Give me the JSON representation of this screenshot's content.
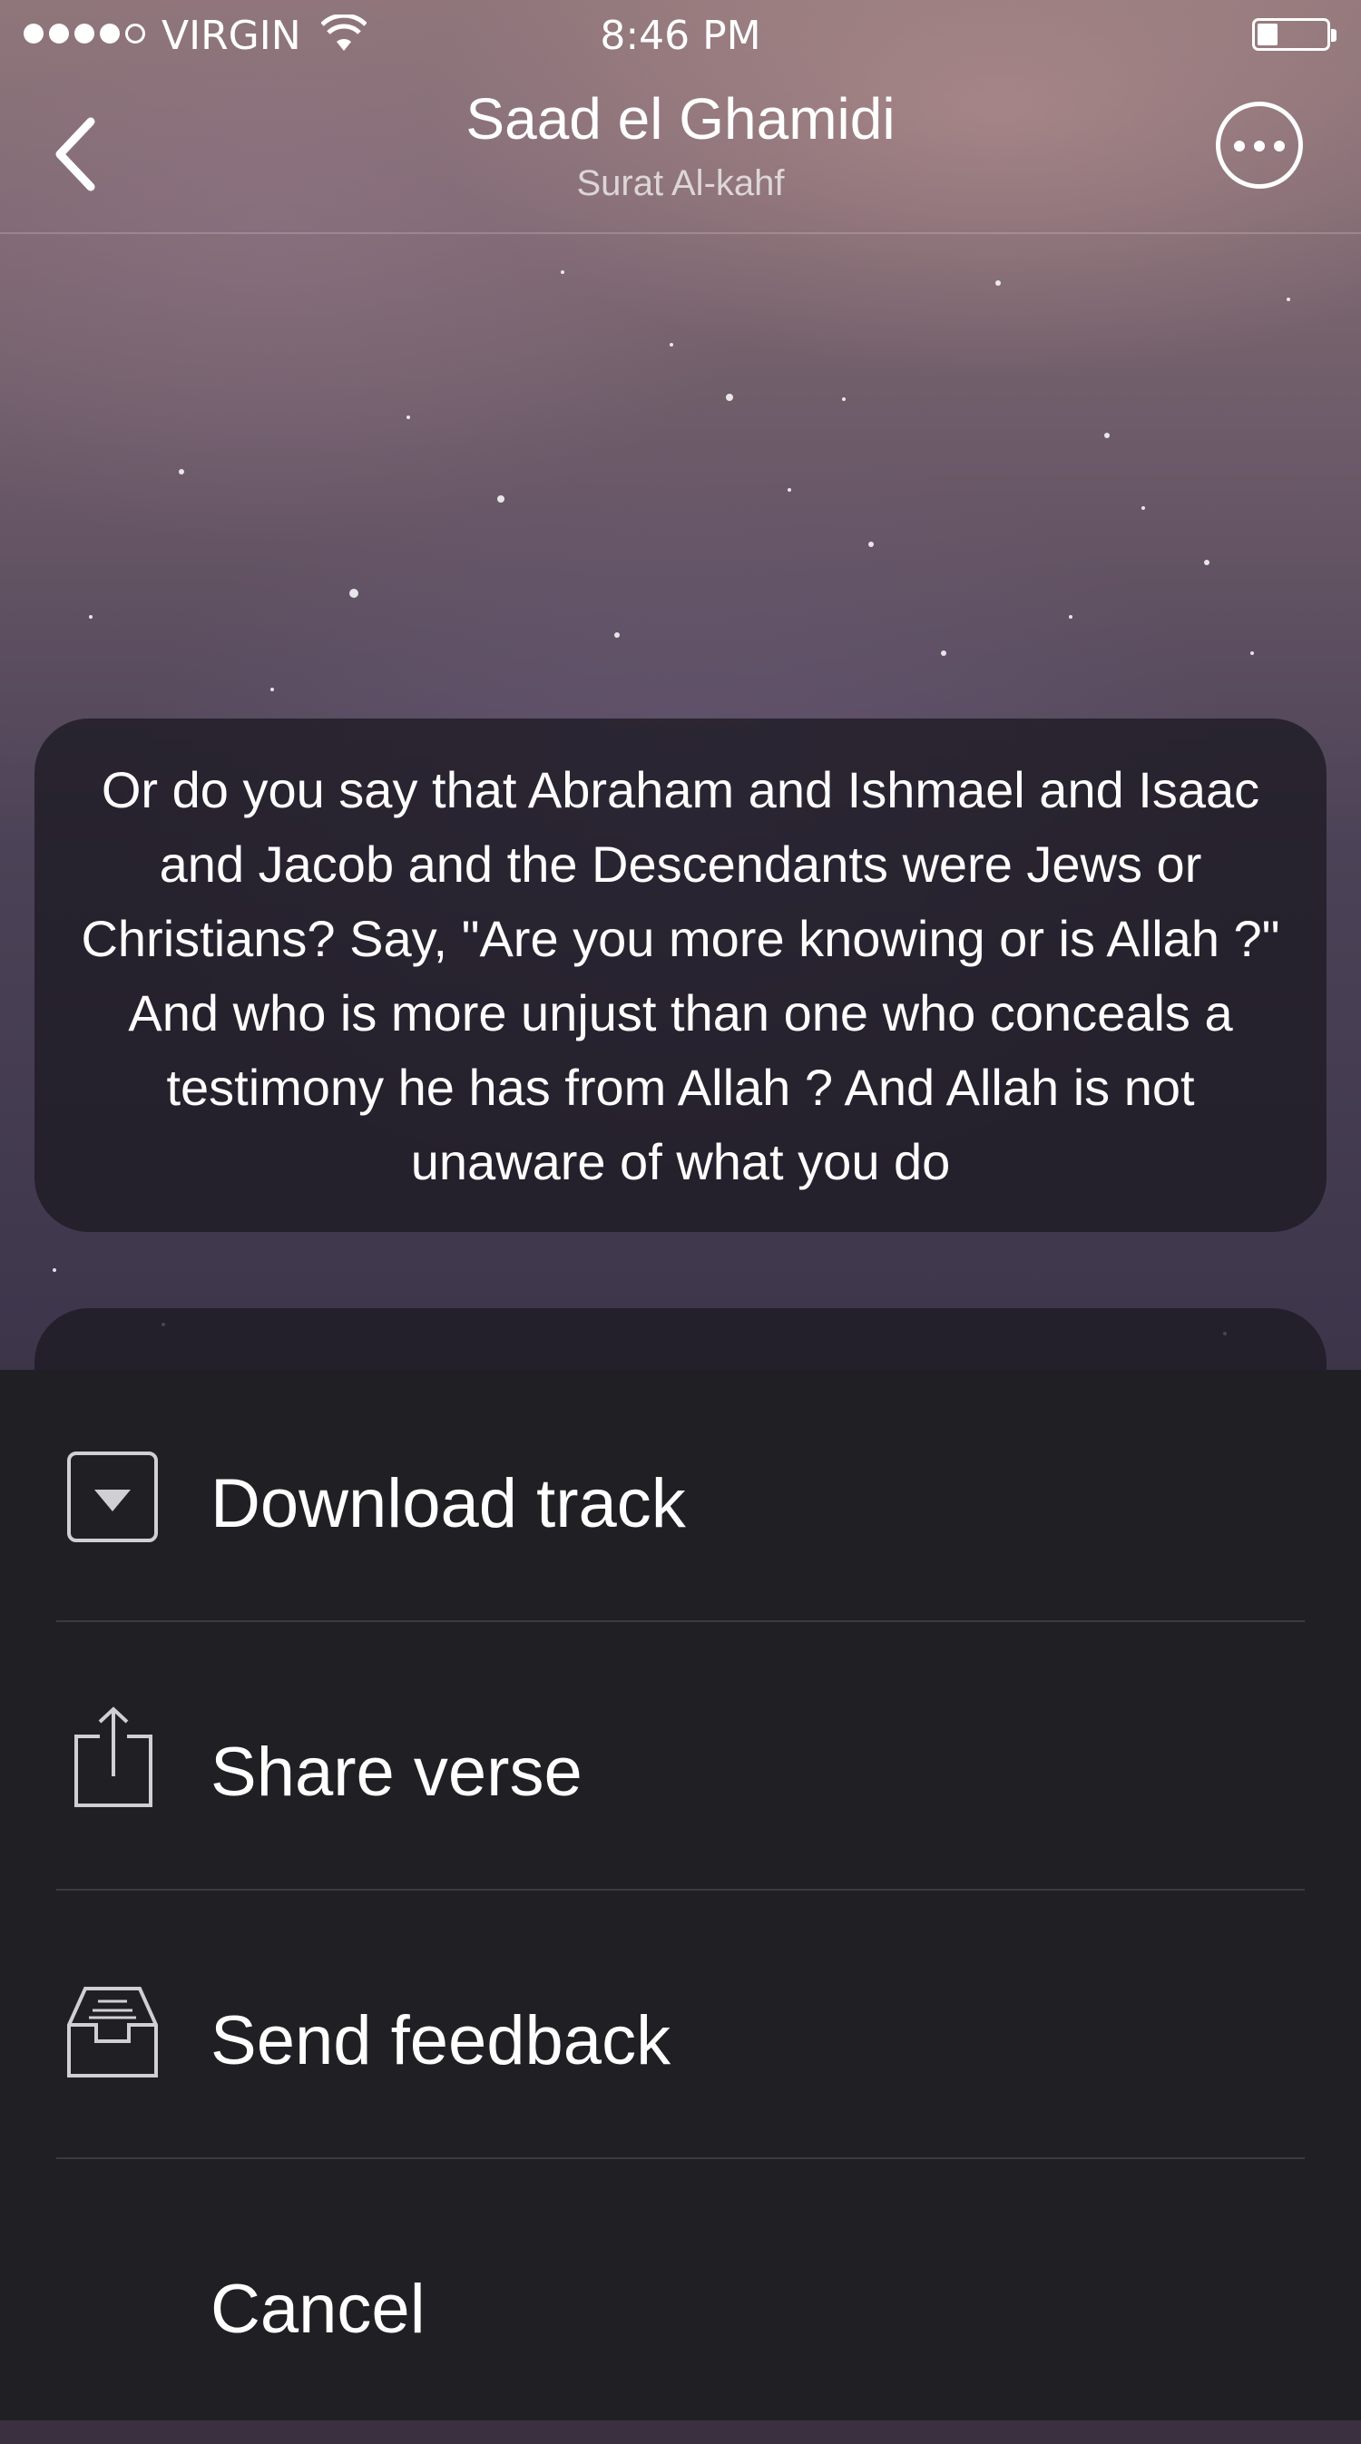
{
  "status_bar": {
    "carrier": "VIRGIN",
    "time": "8:46 PM"
  },
  "nav": {
    "title": "Saad el Ghamidi",
    "subtitle": "Surat Al-kahf"
  },
  "verse": {
    "text": "Or do you say that Abraham and Ishmael and Isaac and Jacob and the Descendants were Jews or Christians? Say, \"Are you more knowing or is Allah ?\" And who is more unjust than one who conceals a testimony he has from Allah ? And Allah is not unaware of what you do"
  },
  "action_sheet": {
    "items": [
      {
        "label": "Download track",
        "icon": "download-icon"
      },
      {
        "label": "Share verse",
        "icon": "share-icon"
      },
      {
        "label": "Send feedback",
        "icon": "inbox-icon"
      },
      {
        "label": "Cancel"
      }
    ]
  },
  "colors": {
    "sheet_background": "#202024",
    "divider": "#3a3a40"
  }
}
